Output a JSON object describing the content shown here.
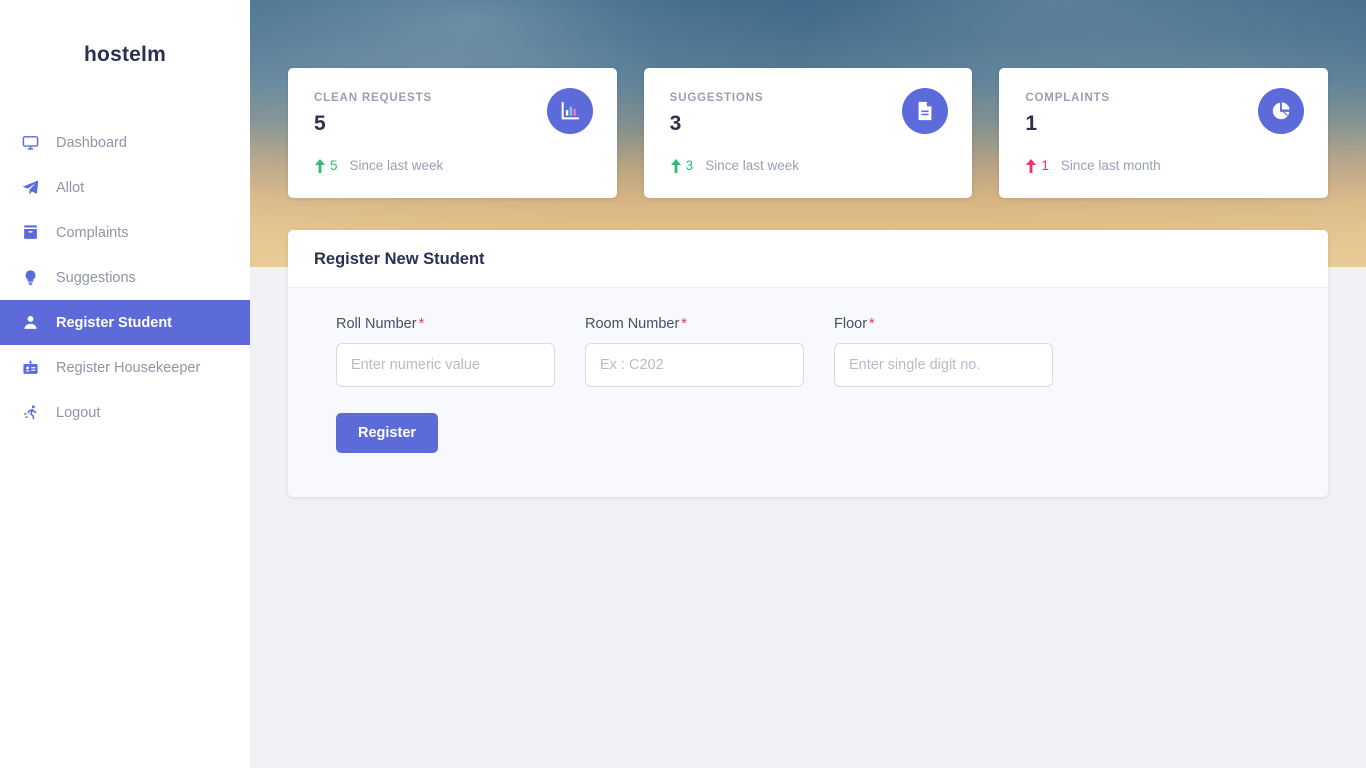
{
  "sidebar": {
    "brand": "hostelm",
    "items": [
      {
        "label": "Dashboard",
        "icon": "monitor-icon",
        "active": false
      },
      {
        "label": "Allot",
        "icon": "paper-plane-icon",
        "active": false
      },
      {
        "label": "Complaints",
        "icon": "archive-box-icon",
        "active": false
      },
      {
        "label": "Suggestions",
        "icon": "lightbulb-icon",
        "active": false
      },
      {
        "label": "Register Student",
        "icon": "user-icon",
        "active": true
      },
      {
        "label": "Register Housekeeper",
        "icon": "id-card-icon",
        "active": false
      },
      {
        "label": "Logout",
        "icon": "running-person-icon",
        "active": false
      }
    ]
  },
  "stats": [
    {
      "title": "CLEAN REQUESTS",
      "value": "5",
      "trend_direction": "up",
      "trend_value": "5",
      "trend_text": "Since last week",
      "icon": "bar-chart-icon",
      "trend_color": "#2dbd76"
    },
    {
      "title": "SUGGESTIONS",
      "value": "3",
      "trend_direction": "up",
      "trend_value": "3",
      "trend_text": "Since last week",
      "icon": "document-icon",
      "trend_color": "#2dbd76"
    },
    {
      "title": "COMPLAINTS",
      "value": "1",
      "trend_direction": "up",
      "trend_value": "1",
      "trend_text": "Since last month",
      "icon": "pie-chart-icon",
      "trend_color": "#e8336d"
    }
  ],
  "form": {
    "title": "Register New Student",
    "required_marker": "*",
    "fields": [
      {
        "label": "Roll Number",
        "placeholder": "Enter numeric value",
        "value": ""
      },
      {
        "label": "Room Number",
        "placeholder": "Ex : C202",
        "value": ""
      },
      {
        "label": "Floor",
        "placeholder": "Enter single digit no.",
        "value": ""
      }
    ],
    "submit_label": "Register"
  },
  "theme": {
    "accent": "#5c6bd9",
    "text_dark": "#2c3050",
    "text_muted": "#9aa0b4",
    "success": "#2dbd76",
    "danger": "#e8336d",
    "page_bg": "#f0f1f6",
    "form_body_bg": "#f7f9fc"
  }
}
